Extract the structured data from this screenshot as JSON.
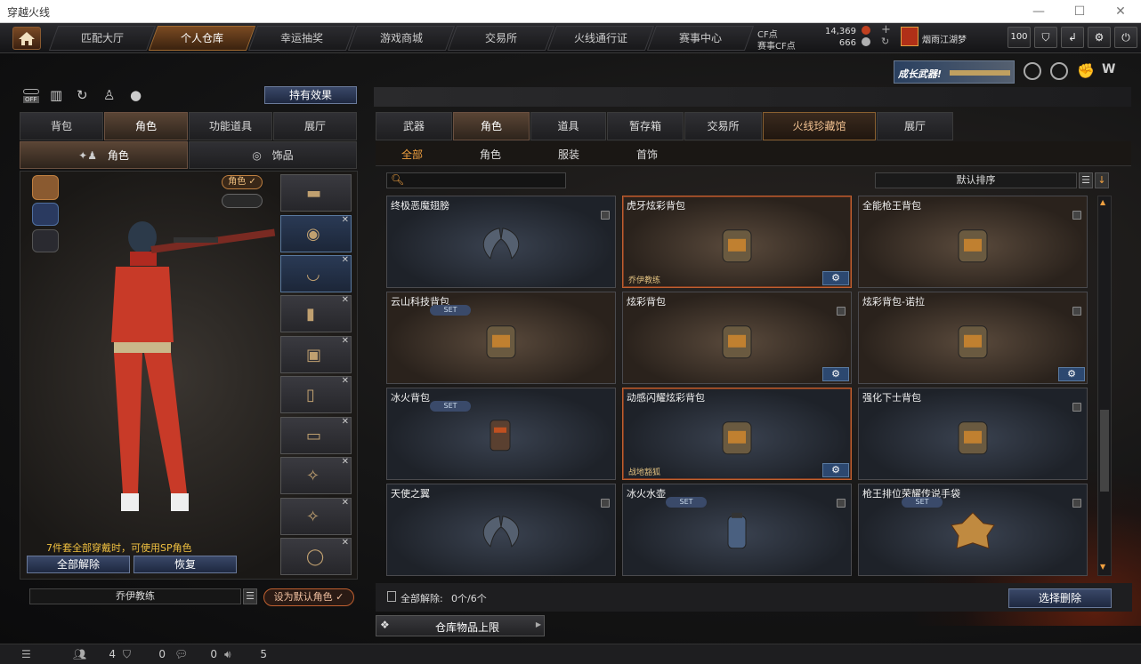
{
  "window": {
    "title": "穿越火线"
  },
  "nav": {
    "tabs": [
      "匹配大厅",
      "个人仓库",
      "幸运抽奖",
      "游戏商城",
      "交易所",
      "火线通行证",
      "赛事中心"
    ],
    "active": 1
  },
  "currency": {
    "cf_label": "CF点",
    "cf_value": "14,369",
    "match_label": "赛事CF点",
    "match_value": "666"
  },
  "user": {
    "name": "烟雨江湖梦",
    "level_badge": "100"
  },
  "promo": {
    "text": "成长武器!"
  },
  "left": {
    "effects_button": "持有效果",
    "toggle_label": "OFF",
    "tabs": [
      "背包",
      "角色",
      "功能道具",
      "展厅"
    ],
    "active_tab": 1,
    "subtabs": [
      "角色",
      "饰品"
    ],
    "role_badge": "角色",
    "set_notice": "7件套全部穿戴时，可使用SP角色",
    "unequip_all": "全部解除",
    "restore": "恢复",
    "character_name": "乔伊教练",
    "set_default": "设为默认角色"
  },
  "right": {
    "tabs": [
      "武器",
      "角色",
      "道具",
      "暂存箱",
      "交易所",
      "火线珍藏馆",
      "展厅"
    ],
    "active_tab": 1,
    "highlight_tab": 5,
    "subtabs": [
      "全部",
      "角色",
      "服装",
      "首饰"
    ],
    "active_subtab": 0,
    "search_placeholder": "",
    "sort_label": "默认排序",
    "items": [
      {
        "name": "终极恶魔翅膀",
        "style": "blue",
        "lock": true,
        "set": false,
        "gear": false,
        "tag": "",
        "icon": "wings-icon"
      },
      {
        "name": "虎牙炫彩背包",
        "style": "brown",
        "lock": false,
        "set": false,
        "gear": true,
        "tag": "乔伊教练",
        "icon": "backpack-icon",
        "selected": true
      },
      {
        "name": "全能枪王背包",
        "style": "brown",
        "lock": true,
        "set": false,
        "gear": false,
        "tag": "",
        "icon": "backpack-icon"
      },
      {
        "name": "云山科技背包",
        "style": "brown",
        "lock": false,
        "set": true,
        "gear": false,
        "tag": "",
        "icon": "backpack-icon"
      },
      {
        "name": "炫彩背包",
        "style": "brown",
        "lock": true,
        "set": false,
        "gear": true,
        "tag": "",
        "icon": "backpack-icon"
      },
      {
        "name": "炫彩背包-诺拉",
        "style": "brown",
        "lock": true,
        "set": false,
        "gear": true,
        "tag": "",
        "icon": "backpack-icon"
      },
      {
        "name": "冰火背包",
        "style": "blue",
        "lock": false,
        "set": true,
        "gear": false,
        "tag": "",
        "icon": "canister-icon"
      },
      {
        "name": "动感闪耀炫彩背包",
        "style": "blue",
        "lock": false,
        "set": false,
        "gear": true,
        "tag": "战地豁狐",
        "icon": "backpack-icon",
        "selected": true
      },
      {
        "name": "强化下士背包",
        "style": "blue",
        "lock": true,
        "set": false,
        "gear": false,
        "tag": "",
        "icon": "backpack-icon"
      },
      {
        "name": "天使之翼",
        "style": "blue",
        "lock": true,
        "set": false,
        "gear": false,
        "tag": "",
        "icon": "wings-icon"
      },
      {
        "name": "冰火水壶",
        "style": "blue",
        "lock": true,
        "set": true,
        "gear": false,
        "tag": "",
        "icon": "canteen-icon"
      },
      {
        "name": "枪王排位荣耀传说手袋",
        "style": "blue",
        "lock": true,
        "set": true,
        "gear": false,
        "tag": "",
        "icon": "emblem-icon"
      }
    ],
    "unequip_all_label": "全部解除:",
    "unequip_count": "0个/6个",
    "select_delete": "选择删除",
    "storage_limit": "仓库物品上限"
  },
  "status": {
    "friends": "4",
    "shield": "0",
    "chat": "0",
    "volume": "5"
  },
  "colors": {
    "accent": "#f0a040",
    "tab_active": "#5a4535",
    "button_blue": "#3a4868"
  }
}
